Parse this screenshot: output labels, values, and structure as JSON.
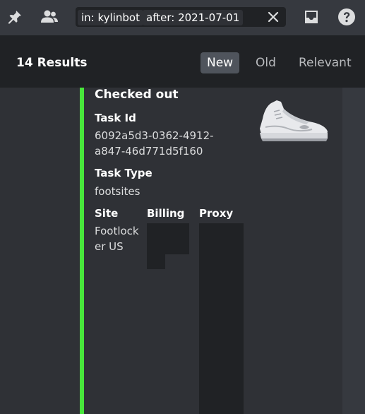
{
  "search": {
    "filter_in_key": "in:",
    "filter_in_value": "kylinbot",
    "filter_after_key": "after:",
    "filter_after_value": "2021-07-01"
  },
  "results": {
    "count_label": "14 Results",
    "sort_tabs": [
      "New",
      "Old",
      "Relevant"
    ],
    "active_sort": "New"
  },
  "embed": {
    "accent_color": "#48e53b",
    "title": "Checked out",
    "fields": {
      "task_id_name": "Task Id",
      "task_id_value_line1": "6092a5d3-0362-4912-",
      "task_id_value_line2": "a847-46d771d5f160",
      "task_type_name": "Task Type",
      "task_type_value": "footsites",
      "site_name": "Site",
      "site_value_line1": "Footlock",
      "site_value_line2": "er US",
      "billing_name": "Billing",
      "proxy_name": "Proxy"
    },
    "thumbnail": "sneaker-image"
  },
  "icons": {
    "pin": "pin-icon",
    "members": "members-icon",
    "clear": "close-icon",
    "inbox": "inbox-icon",
    "help": "help-icon"
  }
}
